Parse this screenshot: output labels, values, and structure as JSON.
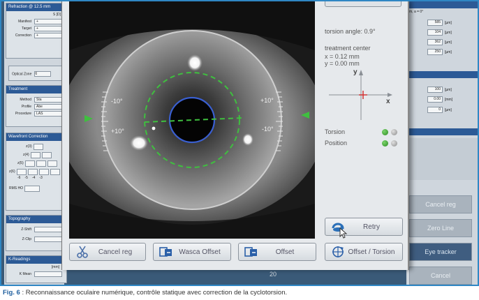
{
  "left_panel": {
    "refraction_title": "Refraction @ 12.5 mm",
    "refraction_sub": "S [D]",
    "refraction_rows": [
      {
        "label": "Manifest",
        "value": "+"
      },
      {
        "label": "Target",
        "value": "+"
      },
      {
        "label": "Correction",
        "value": "+"
      }
    ],
    "optical_zone_label": "Optical Zone",
    "optical_zone_value": "6",
    "treatment_title": "Treatment",
    "treatment_rows": [
      {
        "label": "Method",
        "value": "Sta"
      },
      {
        "label": "Profile",
        "value": "Abe"
      },
      {
        "label": "Procedure",
        "value": "LAS"
      }
    ],
    "wavefront_title": "Wavefront Correction",
    "wavefront_labels": [
      "z(3)",
      "z(4)",
      "z(5)",
      "z(6)"
    ],
    "wavefront_indices": [
      "-6",
      "-5",
      "-4",
      "-3"
    ],
    "rms_label": "RMS HO",
    "topography_title": "Topography",
    "topography_rows": [
      {
        "label": "Z-Shift"
      },
      {
        "label": "Z-Clip"
      }
    ],
    "k_title": "K-Readings",
    "k_row_label": "K Mean",
    "k_sub": "[mm]"
  },
  "right_panel": {
    "head1": "m, a = 0°",
    "rows": [
      {
        "value": "585",
        "unit": "[µm]"
      },
      {
        "value": "104",
        "unit": "[µm]"
      },
      {
        "value": "362",
        "unit": "[µm]"
      },
      {
        "value": "250",
        "unit": "[µm]"
      },
      {
        "value": "100",
        "unit": "[µm]"
      },
      {
        "value": "0.00",
        "unit": "[mm]"
      },
      {
        "value": "0",
        "unit": "[µm]"
      }
    ],
    "buttons": [
      {
        "label": "Cancel reg"
      },
      {
        "label": "Zero Line"
      },
      {
        "label": "Eye tracker"
      },
      {
        "label": "Cancel"
      }
    ]
  },
  "eye_view": {
    "scale_labels": {
      "left_top": "-10°",
      "left_bottom": "+10°",
      "right_top": "+10°",
      "right_bottom": "-10°"
    }
  },
  "info_panel": {
    "torsion_angle": "torsion angle: 0.9°",
    "treatment_center": "treatment center",
    "x_value": "x = 0.12 mm",
    "y_value": "y = 0.00 mm",
    "axis_y": "y",
    "axis_x": "x",
    "torsion_label": "Torsion",
    "position_label": "Position"
  },
  "buttons": {
    "retry": "Retry",
    "cancel_reg": "Cancel reg",
    "wasca_offset": "Wasca Offset",
    "offset": "Offset",
    "offset_torsion": "Offset / Torsion"
  },
  "background_number": "20",
  "caption": {
    "fig": "Fig. 6",
    "text": " : Reconnaissance oculaire numérique, contrôle statique avec correction de la cyclotorsion."
  },
  "colors": {
    "accent": "#2c5a96",
    "status_green": "#3a9a2e",
    "ring_green": "#3fbf3f",
    "pupil_blue": "#3a5fd0"
  }
}
